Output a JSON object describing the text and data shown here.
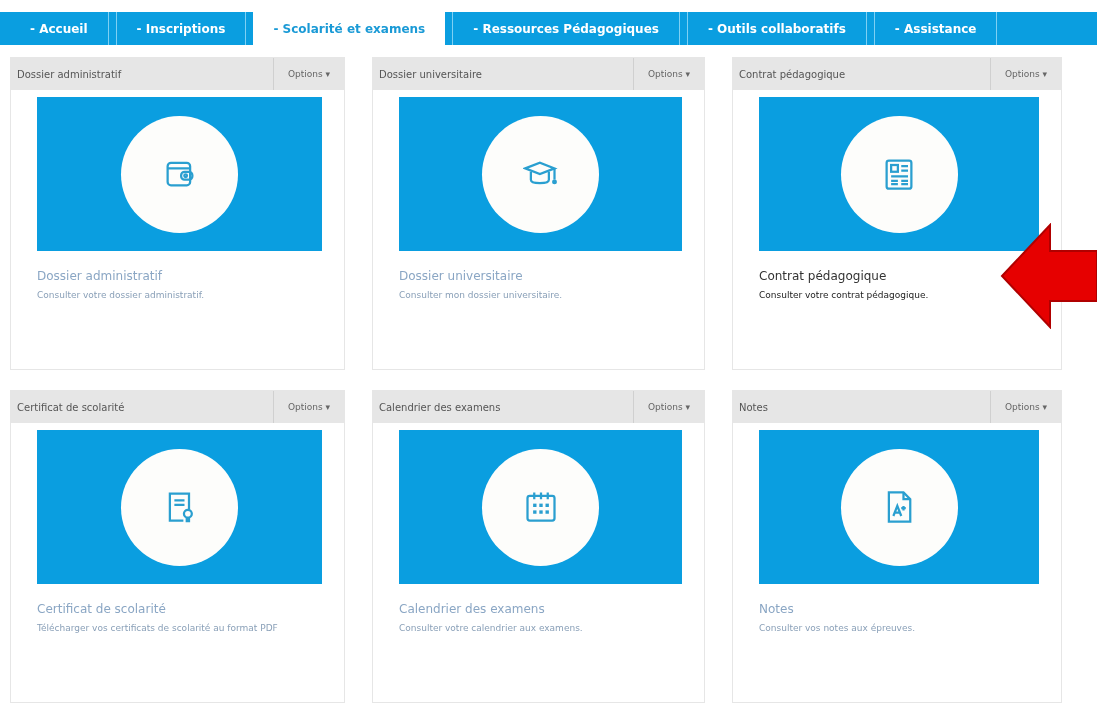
{
  "tabs": [
    {
      "label": "- Accueil",
      "selected": false
    },
    {
      "label": "- Inscriptions",
      "selected": false
    },
    {
      "label": "- Scolarité et examens",
      "selected": true
    },
    {
      "label": "- Ressources Pédagogiques",
      "selected": false
    },
    {
      "label": "- Outils collaboratifs",
      "selected": false
    },
    {
      "label": "- Assistance",
      "selected": false
    }
  ],
  "cards": [
    {
      "header": "Dossier administratif",
      "options": "Options ▾",
      "title": "Dossier administratif",
      "description": "Consulter votre dossier administratif.",
      "highlighted": false
    },
    {
      "header": "Dossier universitaire",
      "options": "Options ▾",
      "title": "Dossier universitaire",
      "description": "Consulter mon dossier universitaire.",
      "highlighted": false
    },
    {
      "header": "Contrat pédagogique",
      "options": "Options ▾",
      "title": "Contrat pédagogique",
      "description": "Consulter votre contrat pédagogique.",
      "highlighted": true
    },
    {
      "header": "Certificat de scolarité",
      "options": "Options ▾",
      "title": "Certificat de scolarité",
      "description": "Télécharger vos certificats de scolarité au format PDF",
      "highlighted": false
    },
    {
      "header": "Calendrier des examens",
      "options": "Options ▾",
      "title": "Calendrier des examens",
      "description": "Consulter votre calendrier aux examens.",
      "highlighted": false
    },
    {
      "header": "Notes",
      "options": "Options ▾",
      "title": "Notes",
      "description": "Consulter vos notes aux épreuves.",
      "highlighted": false
    }
  ]
}
